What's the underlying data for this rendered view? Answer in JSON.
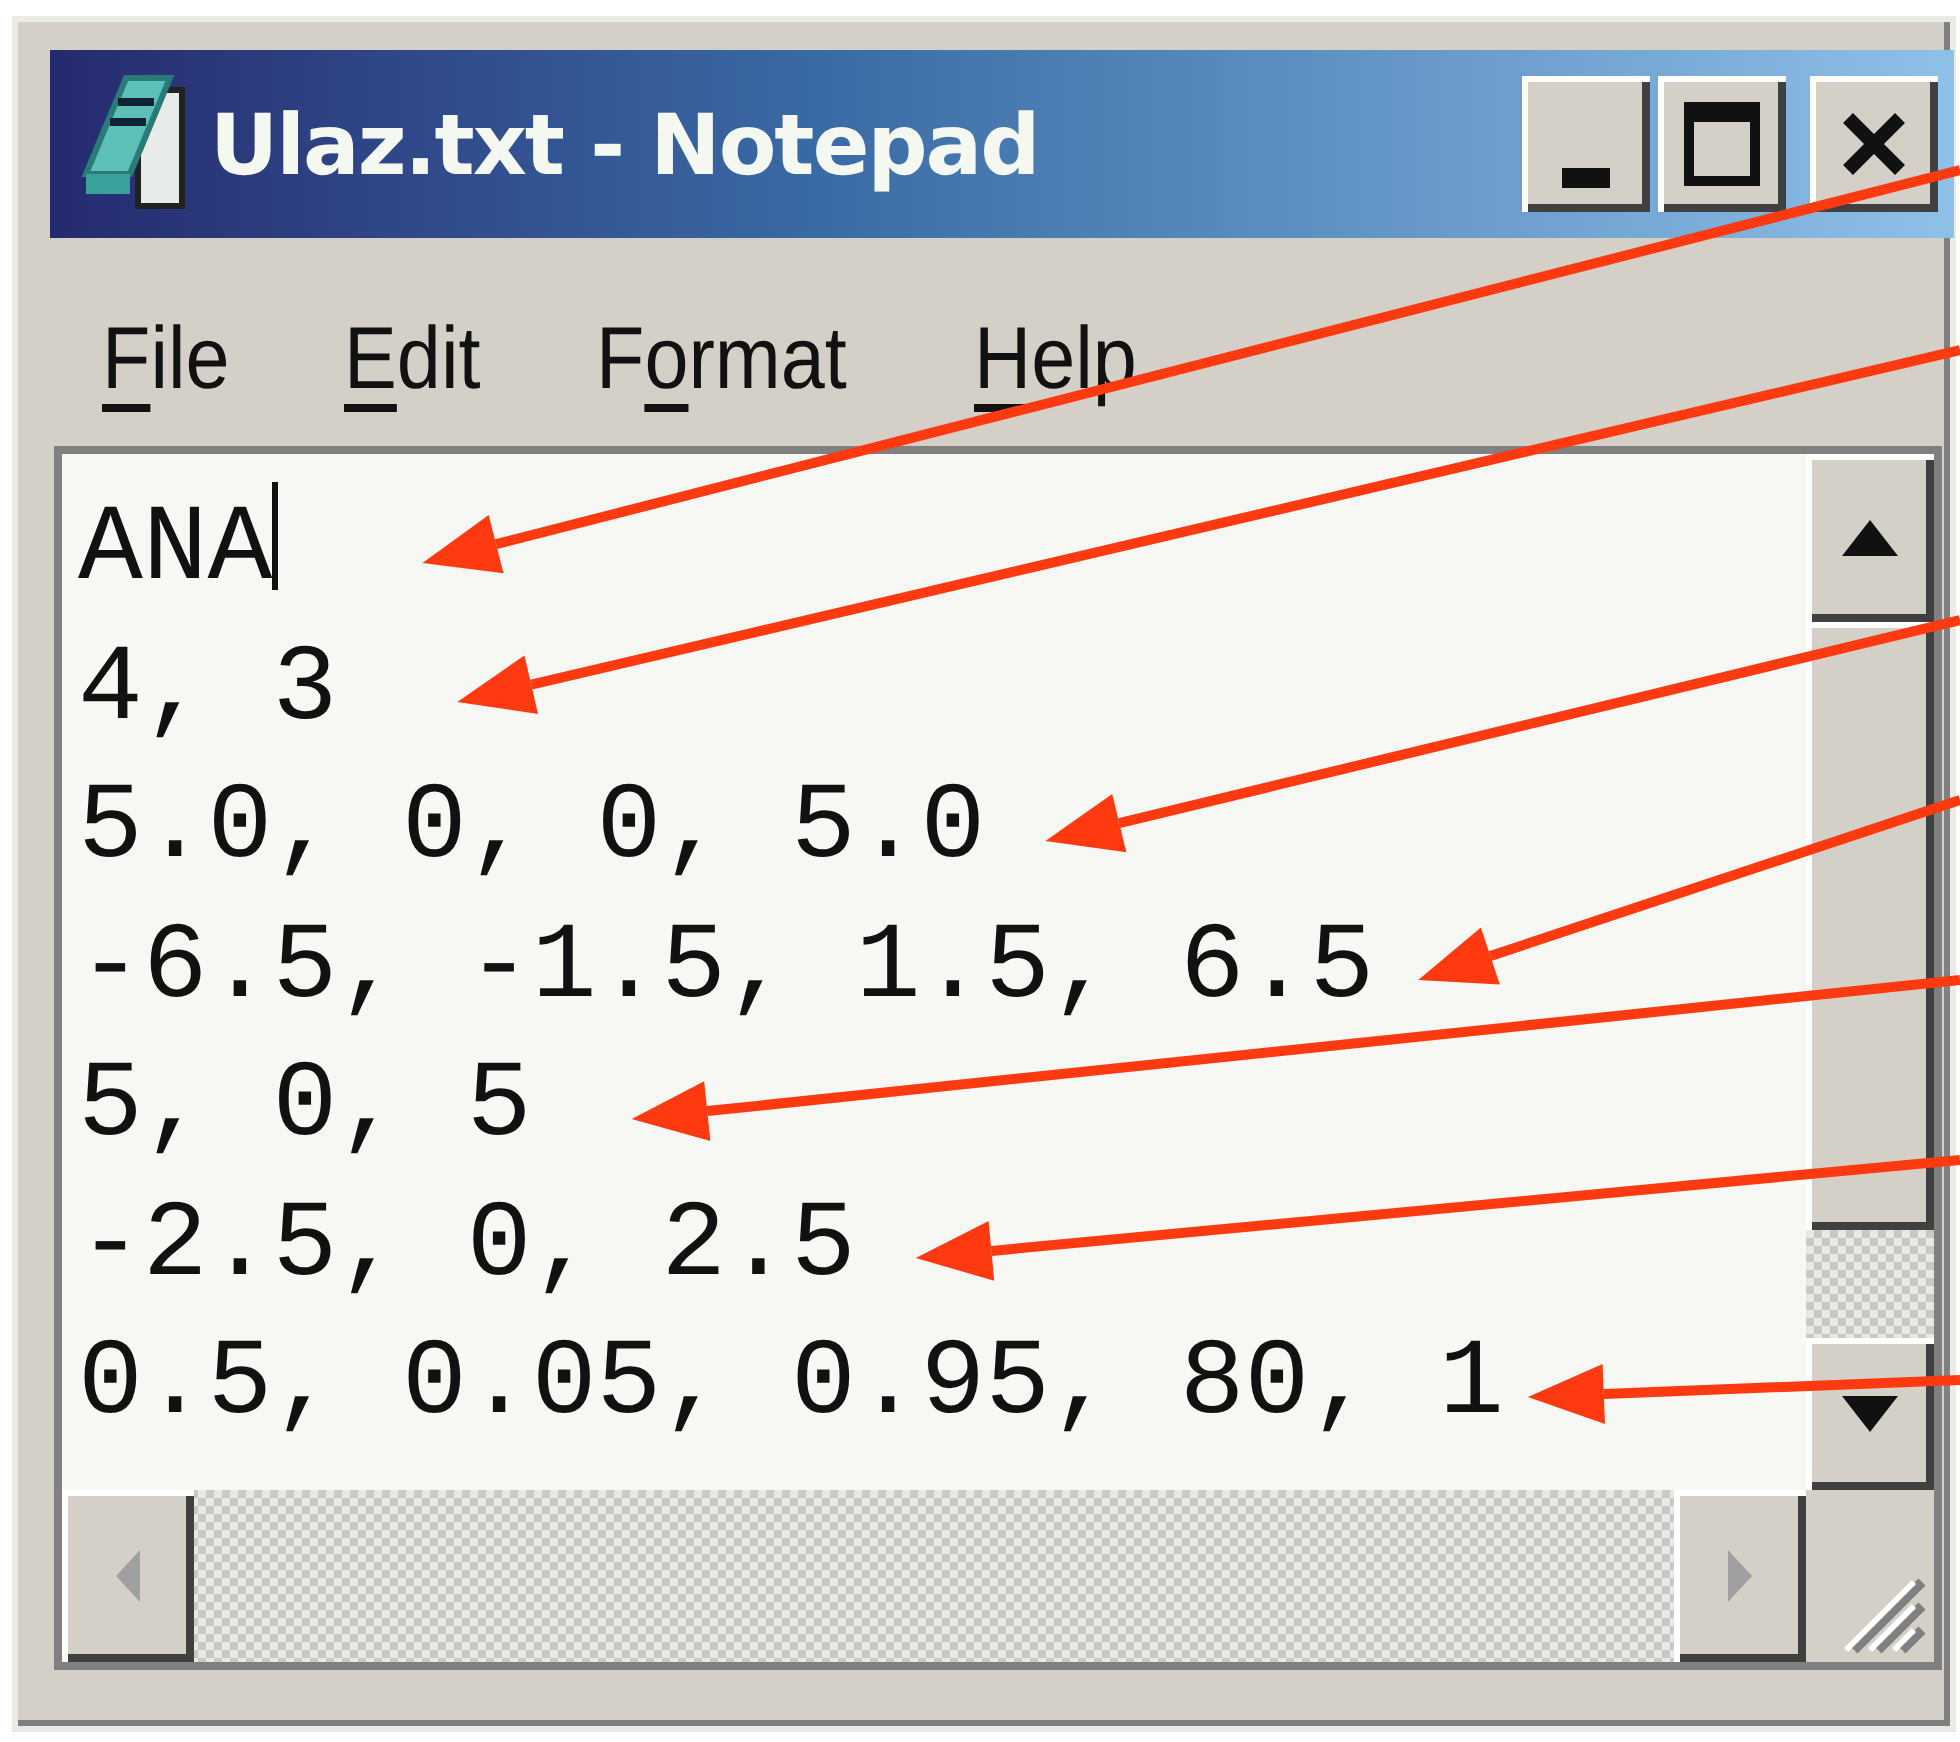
{
  "window": {
    "title": "Ulaz.txt - Notepad"
  },
  "menu": [
    {
      "key": "F",
      "post": "ile"
    },
    {
      "key": "E",
      "post": "dit"
    },
    {
      "pre": "F",
      "key": "o",
      "post": "rmat"
    },
    {
      "key": "H",
      "post": "elp"
    }
  ],
  "lines": [
    {
      "text": "ANA",
      "caret": true,
      "marked": true
    },
    {
      "text": "4, 3",
      "caret": false,
      "marked": true
    },
    {
      "text": "5.0, 0, 0, 5.0",
      "caret": false,
      "marked": true
    },
    {
      "text": "-6.5, -1.5, 1.5, 6.5",
      "caret": false,
      "marked": true
    },
    {
      "text": "5, 0, 5",
      "caret": false,
      "marked": true
    },
    {
      "text": "-2.5, 0, 2.5",
      "caret": false,
      "marked": true
    },
    {
      "text": "0.5, 0.05, 0.95, 80, 1",
      "caret": false,
      "marked": true
    }
  ]
}
